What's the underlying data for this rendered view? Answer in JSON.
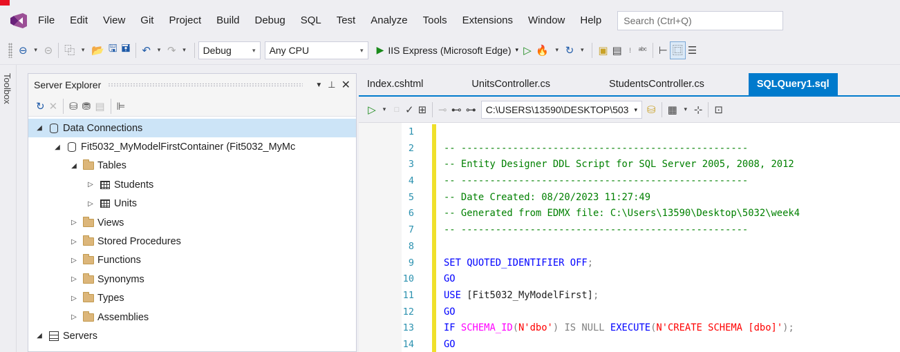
{
  "menu": {
    "items": [
      "File",
      "Edit",
      "View",
      "Git",
      "Project",
      "Build",
      "Debug",
      "SQL",
      "Test",
      "Analyze",
      "Tools",
      "Extensions",
      "Window",
      "Help"
    ],
    "search_placeholder": "Search (Ctrl+Q)"
  },
  "toolbar": {
    "configuration": "Debug",
    "platform": "Any CPU",
    "run_target": "IIS Express (Microsoft Edge)"
  },
  "toolbox": {
    "label": "Toolbox"
  },
  "server_explorer": {
    "title": "Server Explorer",
    "tree": [
      {
        "label": "Data Connections",
        "level": 0,
        "expanded": true,
        "icon": "data-connections-icon",
        "selected": true
      },
      {
        "label": "Fit5032_MyModelFirstContainer (Fit5032_MyMc",
        "level": 1,
        "expanded": true,
        "icon": "database-connection-icon"
      },
      {
        "label": "Tables",
        "level": 2,
        "expanded": true,
        "icon": "folder-icon"
      },
      {
        "label": "Students",
        "level": 3,
        "expanded": false,
        "icon": "table-icon"
      },
      {
        "label": "Units",
        "level": 3,
        "expanded": false,
        "icon": "table-icon"
      },
      {
        "label": "Views",
        "level": 2,
        "expanded": false,
        "icon": "folder-icon"
      },
      {
        "label": "Stored Procedures",
        "level": 2,
        "expanded": false,
        "icon": "folder-icon"
      },
      {
        "label": "Functions",
        "level": 2,
        "expanded": false,
        "icon": "folder-icon"
      },
      {
        "label": "Synonyms",
        "level": 2,
        "expanded": false,
        "icon": "folder-icon"
      },
      {
        "label": "Types",
        "level": 2,
        "expanded": false,
        "icon": "folder-icon"
      },
      {
        "label": "Assemblies",
        "level": 2,
        "expanded": false,
        "icon": "folder-icon"
      },
      {
        "label": "Servers",
        "level": 0,
        "expanded": true,
        "icon": "servers-icon"
      }
    ]
  },
  "editor": {
    "tabs": [
      {
        "label": "Index.cshtml",
        "active": false
      },
      {
        "label": "UnitsController.cs",
        "active": false
      },
      {
        "label": "StudentsController.cs",
        "active": false
      },
      {
        "label": "SQLQuery1.sql",
        "active": true
      }
    ],
    "connection_path": "C:\\USERS\\13590\\DESKTOP\\503",
    "line_numbers": [
      "1",
      "2",
      "3",
      "4",
      "5",
      "6",
      "7",
      "8",
      "9",
      "10",
      "11",
      "12",
      "13",
      "14"
    ],
    "code": [
      [],
      [
        {
          "t": "-- --------------------------------------------------",
          "c": "com"
        }
      ],
      [
        {
          "t": "-- Entity Designer DDL Script for SQL Server 2005, 2008, 2012",
          "c": "com"
        }
      ],
      [
        {
          "t": "-- --------------------------------------------------",
          "c": "com"
        }
      ],
      [
        {
          "t": "-- Date Created: 08/20/2023 11:27:49",
          "c": "com"
        }
      ],
      [
        {
          "t": "-- Generated from EDMX file: C:\\Users\\13590\\Desktop\\5032\\week4",
          "c": "com"
        }
      ],
      [
        {
          "t": "-- --------------------------------------------------",
          "c": "com"
        }
      ],
      [],
      [
        {
          "t": "SET ",
          "c": "kw"
        },
        {
          "t": "QUOTED_IDENTIFIER ",
          "c": "kw"
        },
        {
          "t": "OFF",
          "c": "kw"
        },
        {
          "t": ";",
          "c": "gray"
        }
      ],
      [
        {
          "t": "GO",
          "c": "kw"
        }
      ],
      [
        {
          "t": "USE ",
          "c": "kw"
        },
        {
          "t": "[Fit5032_MyModelFirst]",
          "c": "blk"
        },
        {
          "t": ";",
          "c": "gray"
        }
      ],
      [
        {
          "t": "GO",
          "c": "kw"
        }
      ],
      [
        {
          "t": "IF ",
          "c": "kw"
        },
        {
          "t": "SCHEMA_ID",
          "c": "fn"
        },
        {
          "t": "(",
          "c": "gray"
        },
        {
          "t": "N'dbo'",
          "c": "str"
        },
        {
          "t": ") ",
          "c": "gray"
        },
        {
          "t": "IS NULL ",
          "c": "gray"
        },
        {
          "t": "EXECUTE",
          "c": "kw"
        },
        {
          "t": "(",
          "c": "gray"
        },
        {
          "t": "N'CREATE SCHEMA [dbo]'",
          "c": "str"
        },
        {
          "t": ");",
          "c": "gray"
        }
      ],
      [
        {
          "t": "GO",
          "c": "kw"
        }
      ]
    ]
  },
  "colors": {
    "accent": "#007acc",
    "selection": "#cce4f7",
    "change_marker": "#efe02a"
  }
}
